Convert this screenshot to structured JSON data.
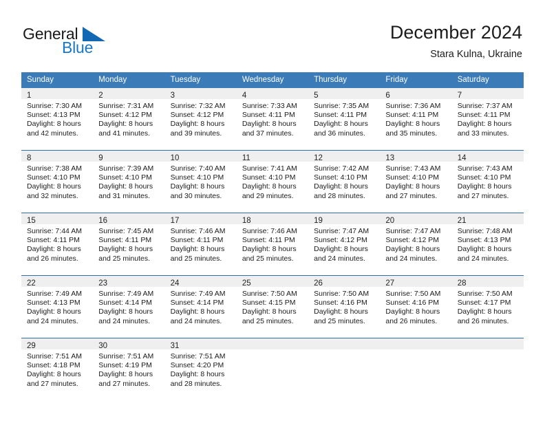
{
  "brand": {
    "name_top": "General",
    "name_bottom": "Blue",
    "triangle_icon": "triangle-icon",
    "color_blue": "#1877c9",
    "color_triangle": "#1268b3"
  },
  "header": {
    "title": "December 2024",
    "subtitle": "Stara Kulna, Ukraine"
  },
  "theme": {
    "header_bar": "#3b7cb8",
    "week_divider": "#2f6fa8",
    "day_band": "#efefef",
    "text": "#1a1a1a"
  },
  "weekdays": [
    "Sunday",
    "Monday",
    "Tuesday",
    "Wednesday",
    "Thursday",
    "Friday",
    "Saturday"
  ],
  "weeks": [
    [
      {
        "day": "1",
        "sunrise": "Sunrise: 7:30 AM",
        "sunset": "Sunset: 4:13 PM",
        "daylight1": "Daylight: 8 hours",
        "daylight2": "and 42 minutes."
      },
      {
        "day": "2",
        "sunrise": "Sunrise: 7:31 AM",
        "sunset": "Sunset: 4:12 PM",
        "daylight1": "Daylight: 8 hours",
        "daylight2": "and 41 minutes."
      },
      {
        "day": "3",
        "sunrise": "Sunrise: 7:32 AM",
        "sunset": "Sunset: 4:12 PM",
        "daylight1": "Daylight: 8 hours",
        "daylight2": "and 39 minutes."
      },
      {
        "day": "4",
        "sunrise": "Sunrise: 7:33 AM",
        "sunset": "Sunset: 4:11 PM",
        "daylight1": "Daylight: 8 hours",
        "daylight2": "and 37 minutes."
      },
      {
        "day": "5",
        "sunrise": "Sunrise: 7:35 AM",
        "sunset": "Sunset: 4:11 PM",
        "daylight1": "Daylight: 8 hours",
        "daylight2": "and 36 minutes."
      },
      {
        "day": "6",
        "sunrise": "Sunrise: 7:36 AM",
        "sunset": "Sunset: 4:11 PM",
        "daylight1": "Daylight: 8 hours",
        "daylight2": "and 35 minutes."
      },
      {
        "day": "7",
        "sunrise": "Sunrise: 7:37 AM",
        "sunset": "Sunset: 4:11 PM",
        "daylight1": "Daylight: 8 hours",
        "daylight2": "and 33 minutes."
      }
    ],
    [
      {
        "day": "8",
        "sunrise": "Sunrise: 7:38 AM",
        "sunset": "Sunset: 4:10 PM",
        "daylight1": "Daylight: 8 hours",
        "daylight2": "and 32 minutes."
      },
      {
        "day": "9",
        "sunrise": "Sunrise: 7:39 AM",
        "sunset": "Sunset: 4:10 PM",
        "daylight1": "Daylight: 8 hours",
        "daylight2": "and 31 minutes."
      },
      {
        "day": "10",
        "sunrise": "Sunrise: 7:40 AM",
        "sunset": "Sunset: 4:10 PM",
        "daylight1": "Daylight: 8 hours",
        "daylight2": "and 30 minutes."
      },
      {
        "day": "11",
        "sunrise": "Sunrise: 7:41 AM",
        "sunset": "Sunset: 4:10 PM",
        "daylight1": "Daylight: 8 hours",
        "daylight2": "and 29 minutes."
      },
      {
        "day": "12",
        "sunrise": "Sunrise: 7:42 AM",
        "sunset": "Sunset: 4:10 PM",
        "daylight1": "Daylight: 8 hours",
        "daylight2": "and 28 minutes."
      },
      {
        "day": "13",
        "sunrise": "Sunrise: 7:43 AM",
        "sunset": "Sunset: 4:10 PM",
        "daylight1": "Daylight: 8 hours",
        "daylight2": "and 27 minutes."
      },
      {
        "day": "14",
        "sunrise": "Sunrise: 7:43 AM",
        "sunset": "Sunset: 4:10 PM",
        "daylight1": "Daylight: 8 hours",
        "daylight2": "and 27 minutes."
      }
    ],
    [
      {
        "day": "15",
        "sunrise": "Sunrise: 7:44 AM",
        "sunset": "Sunset: 4:11 PM",
        "daylight1": "Daylight: 8 hours",
        "daylight2": "and 26 minutes."
      },
      {
        "day": "16",
        "sunrise": "Sunrise: 7:45 AM",
        "sunset": "Sunset: 4:11 PM",
        "daylight1": "Daylight: 8 hours",
        "daylight2": "and 25 minutes."
      },
      {
        "day": "17",
        "sunrise": "Sunrise: 7:46 AM",
        "sunset": "Sunset: 4:11 PM",
        "daylight1": "Daylight: 8 hours",
        "daylight2": "and 25 minutes."
      },
      {
        "day": "18",
        "sunrise": "Sunrise: 7:46 AM",
        "sunset": "Sunset: 4:11 PM",
        "daylight1": "Daylight: 8 hours",
        "daylight2": "and 25 minutes."
      },
      {
        "day": "19",
        "sunrise": "Sunrise: 7:47 AM",
        "sunset": "Sunset: 4:12 PM",
        "daylight1": "Daylight: 8 hours",
        "daylight2": "and 24 minutes."
      },
      {
        "day": "20",
        "sunrise": "Sunrise: 7:47 AM",
        "sunset": "Sunset: 4:12 PM",
        "daylight1": "Daylight: 8 hours",
        "daylight2": "and 24 minutes."
      },
      {
        "day": "21",
        "sunrise": "Sunrise: 7:48 AM",
        "sunset": "Sunset: 4:13 PM",
        "daylight1": "Daylight: 8 hours",
        "daylight2": "and 24 minutes."
      }
    ],
    [
      {
        "day": "22",
        "sunrise": "Sunrise: 7:49 AM",
        "sunset": "Sunset: 4:13 PM",
        "daylight1": "Daylight: 8 hours",
        "daylight2": "and 24 minutes."
      },
      {
        "day": "23",
        "sunrise": "Sunrise: 7:49 AM",
        "sunset": "Sunset: 4:14 PM",
        "daylight1": "Daylight: 8 hours",
        "daylight2": "and 24 minutes."
      },
      {
        "day": "24",
        "sunrise": "Sunrise: 7:49 AM",
        "sunset": "Sunset: 4:14 PM",
        "daylight1": "Daylight: 8 hours",
        "daylight2": "and 24 minutes."
      },
      {
        "day": "25",
        "sunrise": "Sunrise: 7:50 AM",
        "sunset": "Sunset: 4:15 PM",
        "daylight1": "Daylight: 8 hours",
        "daylight2": "and 25 minutes."
      },
      {
        "day": "26",
        "sunrise": "Sunrise: 7:50 AM",
        "sunset": "Sunset: 4:16 PM",
        "daylight1": "Daylight: 8 hours",
        "daylight2": "and 25 minutes."
      },
      {
        "day": "27",
        "sunrise": "Sunrise: 7:50 AM",
        "sunset": "Sunset: 4:16 PM",
        "daylight1": "Daylight: 8 hours",
        "daylight2": "and 26 minutes."
      },
      {
        "day": "28",
        "sunrise": "Sunrise: 7:50 AM",
        "sunset": "Sunset: 4:17 PM",
        "daylight1": "Daylight: 8 hours",
        "daylight2": "and 26 minutes."
      }
    ],
    [
      {
        "day": "29",
        "sunrise": "Sunrise: 7:51 AM",
        "sunset": "Sunset: 4:18 PM",
        "daylight1": "Daylight: 8 hours",
        "daylight2": "and 27 minutes."
      },
      {
        "day": "30",
        "sunrise": "Sunrise: 7:51 AM",
        "sunset": "Sunset: 4:19 PM",
        "daylight1": "Daylight: 8 hours",
        "daylight2": "and 27 minutes."
      },
      {
        "day": "31",
        "sunrise": "Sunrise: 7:51 AM",
        "sunset": "Sunset: 4:20 PM",
        "daylight1": "Daylight: 8 hours",
        "daylight2": "and 28 minutes."
      },
      {
        "day": "",
        "sunrise": "",
        "sunset": "",
        "daylight1": "",
        "daylight2": ""
      },
      {
        "day": "",
        "sunrise": "",
        "sunset": "",
        "daylight1": "",
        "daylight2": ""
      },
      {
        "day": "",
        "sunrise": "",
        "sunset": "",
        "daylight1": "",
        "daylight2": ""
      },
      {
        "day": "",
        "sunrise": "",
        "sunset": "",
        "daylight1": "",
        "daylight2": ""
      }
    ]
  ]
}
